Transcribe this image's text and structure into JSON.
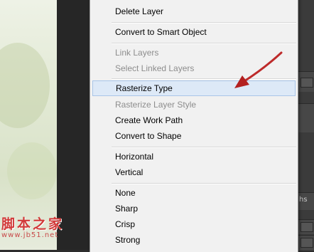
{
  "menu": {
    "items": [
      {
        "label": "Delete Layer",
        "disabled": false
      },
      {
        "label": "Convert to Smart Object",
        "disabled": false
      },
      {
        "label": "Link Layers",
        "disabled": true
      },
      {
        "label": "Select Linked Layers",
        "disabled": true
      },
      {
        "label": "Rasterize Type",
        "disabled": false,
        "highlighted": true
      },
      {
        "label": "Rasterize Layer Style",
        "disabled": true
      },
      {
        "label": "Create Work Path",
        "disabled": false
      },
      {
        "label": "Convert to Shape",
        "disabled": false
      },
      {
        "label": "Horizontal",
        "disabled": false
      },
      {
        "label": "Vertical",
        "disabled": false
      },
      {
        "label": "None",
        "disabled": false
      },
      {
        "label": "Sharp",
        "disabled": false
      },
      {
        "label": "Crisp",
        "disabled": false
      },
      {
        "label": "Strong",
        "disabled": false
      }
    ]
  },
  "right_panel": {
    "partial_label": "hs"
  },
  "annotation": {
    "arrow_color": "#b32020",
    "points_to": "Rasterize Type"
  },
  "watermark": {
    "chinese": "脚本之家",
    "url": "www.jb51.net"
  },
  "colors": {
    "menu_bg": "#f1f1f1",
    "highlight_bg": "#dde9f7",
    "highlight_border": "#a9c5e8",
    "disabled_text": "#8d8d8d"
  }
}
